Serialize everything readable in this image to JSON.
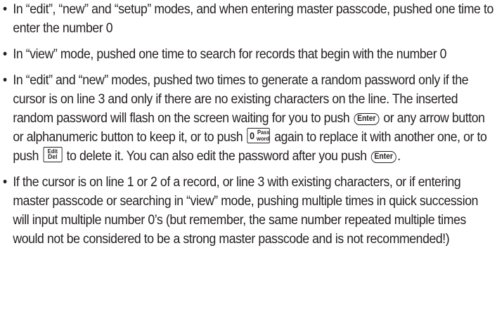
{
  "bullet_char": "•",
  "keys": {
    "enter": "Enter",
    "zero_digit": "0",
    "zero_pass": "Pass",
    "zero_word": "word",
    "edit_top": "Edit",
    "edit_bottom": "Del"
  },
  "items": {
    "item1": {
      "text": "In “edit”, “new” and “setup” modes, and when entering master passcode, pushed one time to enter the number 0"
    },
    "item2": {
      "text": "In “view” mode, pushed one time to search for records that begin with the number 0"
    },
    "item3": {
      "text_a": "In “edit” and “new” modes, pushed two times to generate a random password only if the cursor is on line 3 and only if there are no existing characters on the line. The inserted random password will flash on the screen waiting for you to push ",
      "text_b": " or any arrow button or alphanumeric button to keep it, or to push ",
      "text_c": " again to replace it with another one, or to push ",
      "text_d": " to delete it. You can also edit the password after you push ",
      "text_e": "."
    },
    "item4": {
      "text": "If the cursor is on line 1 or 2 of a record, or line 3 with existing characters, or if entering master passcode or searching in “view” mode, pushing multiple times in quick succession will input multiple number 0’s (but remember, the same number repeated multiple times would not be considered to be a strong master passcode and is not recommended!)"
    }
  }
}
